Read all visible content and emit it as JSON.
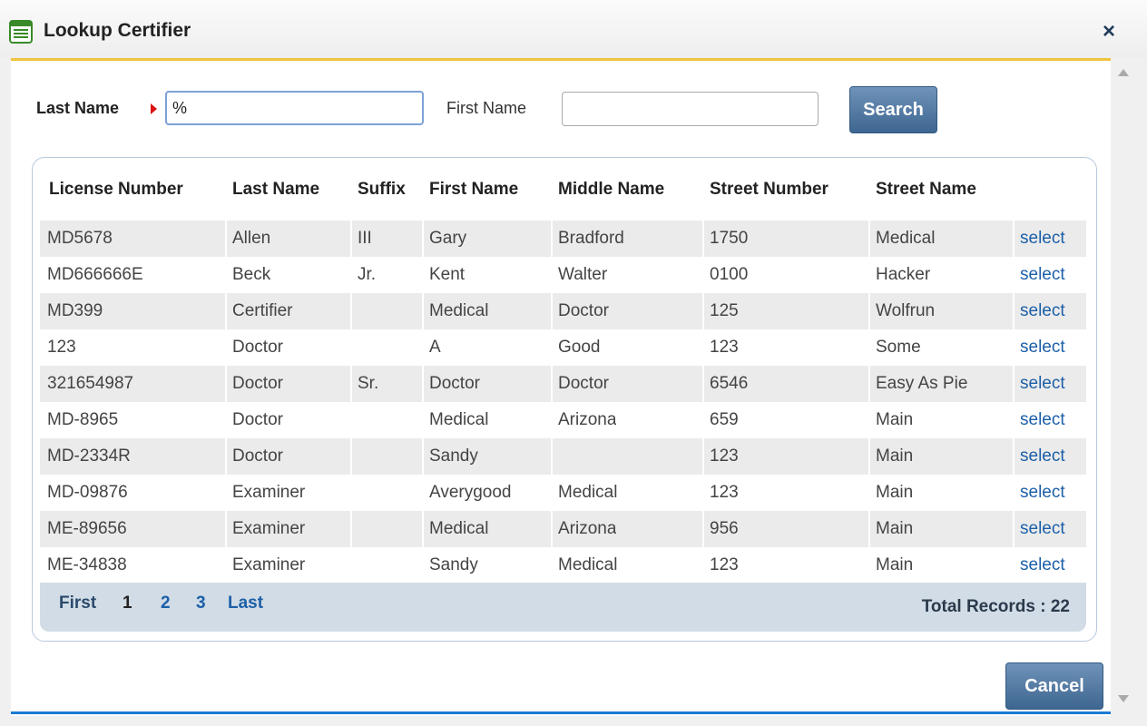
{
  "window": {
    "title": "Lookup Certifier",
    "close_label": "×"
  },
  "search": {
    "last_name_label": "Last Name",
    "last_name_value": "%",
    "first_name_label": "First Name",
    "first_name_value": "",
    "search_button": "Search"
  },
  "table": {
    "columns": [
      "License Number",
      "Last Name",
      "Suffix",
      "First Name",
      "Middle Name",
      "Street Number",
      "Street Name"
    ],
    "select_label": "select",
    "rows": [
      [
        "MD5678",
        "Allen",
        "III",
        "Gary",
        "Bradford",
        "1750",
        "Medical"
      ],
      [
        "MD666666E",
        "Beck",
        "Jr.",
        "Kent",
        "Walter",
        "0100",
        "Hacker"
      ],
      [
        "MD399",
        "Certifier",
        "",
        "Medical",
        "Doctor",
        "125",
        "Wolfrun"
      ],
      [
        "123",
        "Doctor",
        "",
        "A",
        "Good",
        "123",
        "Some"
      ],
      [
        "321654987",
        "Doctor",
        "Sr.",
        "Doctor",
        "Doctor",
        "6546",
        "Easy As Pie"
      ],
      [
        "MD-8965",
        "Doctor",
        "",
        "Medical",
        "Arizona",
        "659",
        "Main"
      ],
      [
        "MD-2334R",
        "Doctor",
        "",
        "Sandy",
        "",
        "123",
        "Main"
      ],
      [
        "MD-09876",
        "Examiner",
        "",
        "Averygood",
        "Medical",
        "123",
        "Main"
      ],
      [
        "ME-89656",
        "Examiner",
        "",
        "Medical",
        "Arizona",
        "956",
        "Main"
      ],
      [
        "ME-34838",
        "Examiner",
        "",
        "Sandy",
        "Medical",
        "123",
        "Main"
      ]
    ]
  },
  "pager": {
    "first": "First",
    "pages": [
      "1",
      "2",
      "3"
    ],
    "current_page": "1",
    "last": "Last",
    "total": "Total Records : 22"
  },
  "footer": {
    "cancel_button": "Cancel"
  },
  "colors": {
    "title_accent": "#f0c33c",
    "link": "#1c5fa8",
    "button": "#3e6690",
    "bottom_line": "#1b7bd4"
  },
  "icons": {
    "title_icon": "form-icon",
    "close_icon": "close-icon",
    "required_marker": "required-arrow-icon"
  }
}
